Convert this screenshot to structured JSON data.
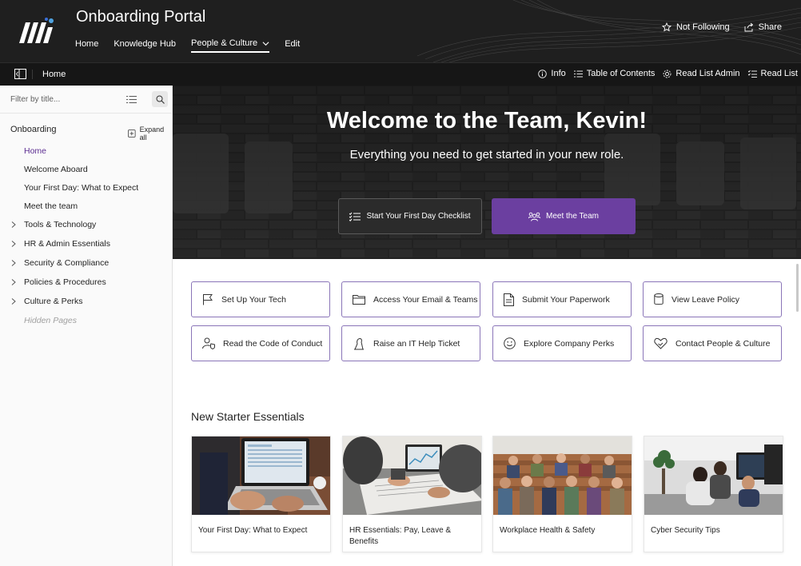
{
  "header": {
    "site_title": "Onboarding Portal",
    "nav": [
      {
        "label": "Home"
      },
      {
        "label": "Knowledge Hub"
      },
      {
        "label": "People & Culture"
      },
      {
        "label": "Edit"
      }
    ],
    "actions": {
      "follow": "Not Following",
      "share": "Share"
    }
  },
  "command_bar": {
    "breadcrumb": "Home",
    "actions": [
      "Info",
      "Table of Contents",
      "Read List Admin",
      "Read List"
    ]
  },
  "sidebar": {
    "filter_placeholder": "Filter by title...",
    "heading": "Onboarding",
    "expand_all": "Expand all",
    "items": [
      {
        "label": "Home",
        "selected": true
      },
      {
        "label": "Welcome Aboard"
      },
      {
        "label": "Your First Day: What to Expect"
      },
      {
        "label": "Meet the team"
      },
      {
        "label": "Tools & Technology",
        "expandable": true
      },
      {
        "label": "HR & Admin Essentials",
        "expandable": true
      },
      {
        "label": "Security & Compliance",
        "expandable": true
      },
      {
        "label": "Policies & Procedures",
        "expandable": true
      },
      {
        "label": "Culture & Perks",
        "expandable": true
      },
      {
        "label": "Hidden Pages"
      }
    ]
  },
  "hero": {
    "title": "Welcome to the Team, Kevin!",
    "subtitle": "Everything you need to get started in your new role.",
    "buttons": {
      "checklist": "Start Your First Day Checklist",
      "meet": "Meet the Team"
    },
    "accent_color": "#6b3fa0"
  },
  "quick_links": [
    {
      "label": "Set Up Your Tech",
      "icon": "flag-icon"
    },
    {
      "label": "Access Your Email & Teams",
      "icon": "folder-icon"
    },
    {
      "label": "Submit Your Paperwork",
      "icon": "document-icon"
    },
    {
      "label": "View Leave Policy",
      "icon": "database-icon"
    },
    {
      "label": "Read the Code of Conduct",
      "icon": "person-shield-icon"
    },
    {
      "label": "Raise an IT Help Ticket",
      "icon": "headset-icon"
    },
    {
      "label": "Explore Company Perks",
      "icon": "smile-icon"
    },
    {
      "label": "Contact People & Culture",
      "icon": "heart-people-icon"
    }
  ],
  "essentials": {
    "title": "New Starter Essentials",
    "cards": [
      {
        "caption": "Your First Day: What to Expect"
      },
      {
        "caption": "HR Essentials: Pay, Leave & Benefits"
      },
      {
        "caption": "Workplace Health & Safety"
      },
      {
        "caption": "Cyber Security Tips"
      }
    ]
  }
}
